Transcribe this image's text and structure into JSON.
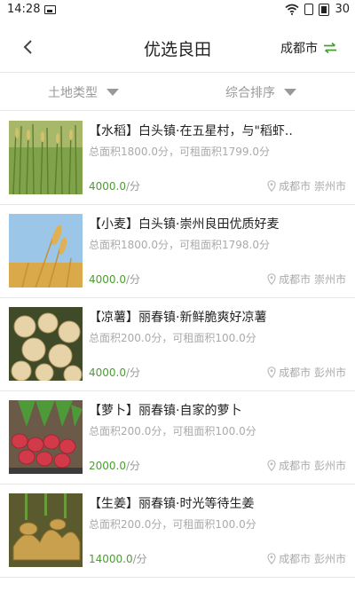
{
  "status": {
    "time": "14:28",
    "battery": "30"
  },
  "header": {
    "title": "优选良田",
    "city": "成都市"
  },
  "filters": {
    "land_type": "土地类型",
    "sort": "综合排序"
  },
  "items": [
    {
      "tag": "【水稻】",
      "title": "白头镇·在五星村，与\"稻虾..",
      "area": "总面积1800.0分，可租面积1799.0分",
      "price": "4000.0",
      "unit": "/分",
      "location": "成都市 崇州市",
      "image": "rice-field-image"
    },
    {
      "tag": "【小麦】",
      "title": "白头镇·崇州良田优质好麦",
      "area": "总面积1800.0分，可租面积1798.0分",
      "price": "4000.0",
      "unit": "/分",
      "location": "成都市 崇州市",
      "image": "wheat-image"
    },
    {
      "tag": "【凉薯】",
      "title": "丽春镇·新鲜脆爽好凉薯",
      "area": "总面积200.0分，可租面积100.0分",
      "price": "4000.0",
      "unit": "/分",
      "location": "成都市 彭州市",
      "image": "jicama-image"
    },
    {
      "tag": "【萝卜】",
      "title": "丽春镇·自家的萝卜",
      "area": "总面积200.0分，可租面积100.0分",
      "price": "2000.0",
      "unit": "/分",
      "location": "成都市 彭州市",
      "image": "radish-image"
    },
    {
      "tag": "【生姜】",
      "title": "丽春镇·时光等待生姜",
      "area": "总面积200.0分，可租面积100.0分",
      "price": "14000.0",
      "unit": "/分",
      "location": "成都市 彭州市",
      "image": "ginger-image"
    }
  ],
  "colors": {
    "accent_green": "#4a9e2f",
    "muted_gray": "#aaaaaa"
  }
}
